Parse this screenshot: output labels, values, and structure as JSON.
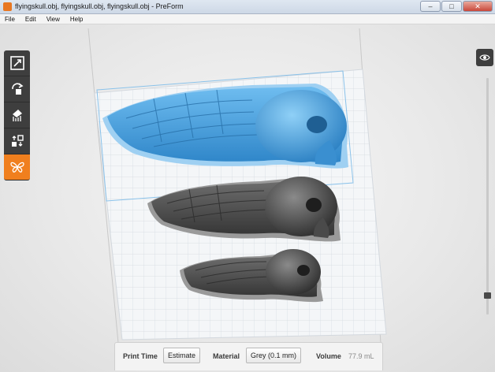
{
  "window": {
    "title": "flyingskull.obj, flyingskull.obj, flyingskull.obj - PreForm",
    "minimize": "–",
    "maximize": "□",
    "close": "✕"
  },
  "menu": {
    "items": [
      "File",
      "Edit",
      "View",
      "Help"
    ]
  },
  "toolbar": {
    "tools": [
      "scale-icon",
      "rotate-icon",
      "supports-icon",
      "layout-icon",
      "butterfly-icon"
    ],
    "active_tool": "butterfly-icon",
    "view_toggle_icon": "eye-cube-icon"
  },
  "colors": {
    "accent": "#f07f1e",
    "selected_model": "#4aa3e0",
    "unselected_model": "#4d4d4d",
    "toolbar_bg": "#3e3e3e"
  },
  "status": {
    "print_time_label": "Print Time",
    "estimate_button": "Estimate",
    "material_label": "Material",
    "material_value": "Grey (0.1 mm)",
    "volume_label": "Volume",
    "volume_value": "77.9 mL"
  }
}
